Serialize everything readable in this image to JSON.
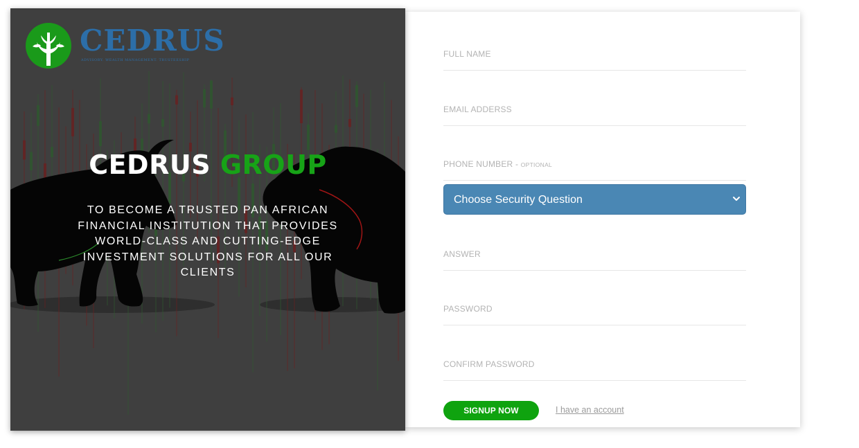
{
  "brand": {
    "logo_text": "CEDRUS",
    "logo_tagline": "Advisory. Wealth Management. Trusteeship",
    "logo_icon": "tree-icon",
    "colors": {
      "green": "#17a317",
      "blue": "#2c6ea8",
      "panel": "#3f3f3f"
    }
  },
  "hero": {
    "title_main": "CEDRUS",
    "title_accent": "GROUP",
    "mission": "To become a trusted pan African financial institution that provides world-class and cutting-edge investment solutions for all our clients"
  },
  "form": {
    "full_name_label": "FULL NAME",
    "email_label": "EMAIL ADDERSS",
    "phone_label": "PHONE NUMBER - ",
    "phone_optional": "OPTIONAL",
    "security_question": {
      "selected": "Choose Security Question",
      "options": [
        "Choose Security Question"
      ],
      "icon": "chevron-down-icon"
    },
    "answer_label": "ANSWER",
    "password_label": "PASSWORD",
    "confirm_password_label": "CONFIRM PASSWORD",
    "signup_label": "SIGNUP NOW",
    "account_link": "I have an account",
    "colors": {
      "button": "#0fa30f",
      "select": "#4a87b4"
    }
  }
}
